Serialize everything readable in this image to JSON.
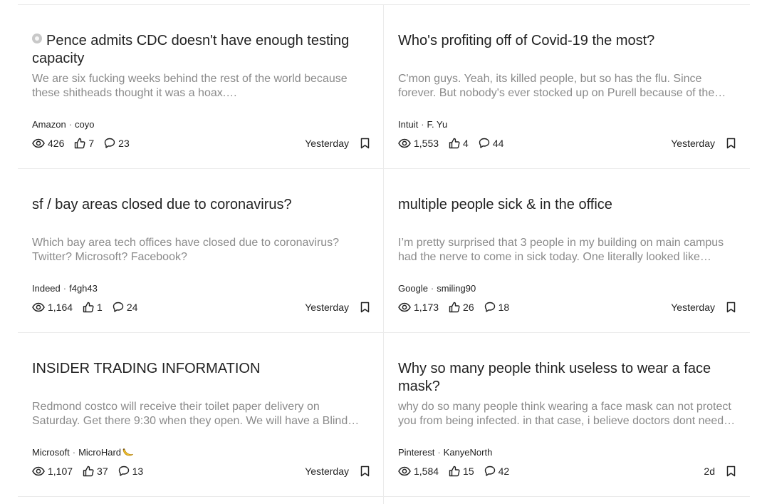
{
  "posts": [
    {
      "title": "Pence admits CDC doesn't have enough testing capacity",
      "has_badge": true,
      "preview": "We are six fucking weeks behind the rest of the world because these shitheads thought it was a hoax. https://m.youtube.com/watch?v=...",
      "company": "Amazon",
      "author": "coyo",
      "views": "426",
      "likes": "7",
      "comments": "23",
      "time": "Yesterday"
    },
    {
      "title": "Who's profiting off of Covid-19 the most?",
      "has_badge": false,
      "preview": "C'mon guys. Yeah, its killed people, but so has the flu. Since forever. But nobody's ever stocked up on Purell because of the flu...",
      "company": "Intuit",
      "author": "F. Yu",
      "views": "1,553",
      "likes": "4",
      "comments": "44",
      "time": "Yesterday"
    },
    {
      "title": "sf / bay areas closed due to coronavirus?",
      "has_badge": false,
      "preview": "Which bay area tech offices have closed due to coronavirus? Twitter? Microsoft? Facebook?",
      "company": "Indeed",
      "author": "f4gh43",
      "views": "1,164",
      "likes": "1",
      "comments": "24",
      "time": "Yesterday"
    },
    {
      "title": "multiple people sick & in the office",
      "has_badge": false,
      "preview": "I’m pretty surprised that 3 people in my building on main campus had the nerve to come in sick today. One literally looked like death...",
      "company": "Google",
      "author": "smiling90",
      "views": "1,173",
      "likes": "26",
      "comments": "18",
      "time": "Yesterday"
    },
    {
      "title": "INSIDER TRADING INFORMATION",
      "has_badge": false,
      "preview": "Redmond costco will receive their toilet paper delivery on Saturday. Get there 9:30 when they open. We will have a Blind meetup there...",
      "company": "Microsoft",
      "author": "MicroHard",
      "author_emoji": "banana-icon",
      "views": "1,107",
      "likes": "37",
      "comments": "13",
      "time": "Yesterday"
    },
    {
      "title": "Why so many people think useless to wear a face mask?",
      "has_badge": false,
      "preview": "why do so many people think wearing a face mask can not protect you from being infected. in that case, i believe doctors dont need to...",
      "company": "Pinterest",
      "author": "KanyeNorth",
      "views": "1,584",
      "likes": "15",
      "comments": "42",
      "time": "2d"
    }
  ],
  "colors": {
    "title": "#222222",
    "preview": "#8a8a8a",
    "divider": "#ebebeb"
  }
}
